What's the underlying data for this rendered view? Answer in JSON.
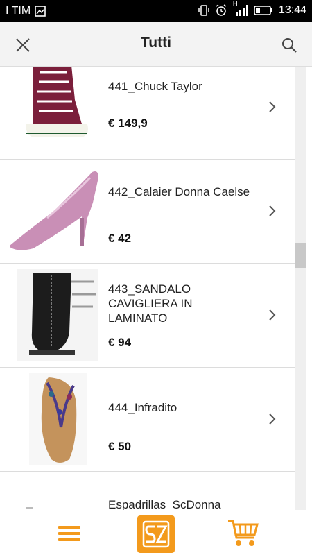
{
  "status_bar": {
    "carrier": "I TIM",
    "time": "13:44",
    "network_label": "H"
  },
  "app_bar": {
    "title": "Tutti"
  },
  "products": [
    {
      "name": "441_Chuck Taylor",
      "price": "€ 149,9"
    },
    {
      "name": "442_Calaier Donna Caelse",
      "price": "€ 42"
    },
    {
      "name": "443_SANDALO CAVIGLIERA IN LAMINATO",
      "price": "€ 94"
    },
    {
      "name": "444_Infradito",
      "price": "€ 50"
    },
    {
      "name": "Espadrillas_ScDonna",
      "price": ""
    }
  ],
  "colors": {
    "accent": "#f39a1c",
    "status_bar": "#000000"
  },
  "icons": [
    "close-icon",
    "search-icon",
    "chevron-right-icon",
    "menu-icon",
    "brand-logo-icon",
    "cart-icon"
  ]
}
